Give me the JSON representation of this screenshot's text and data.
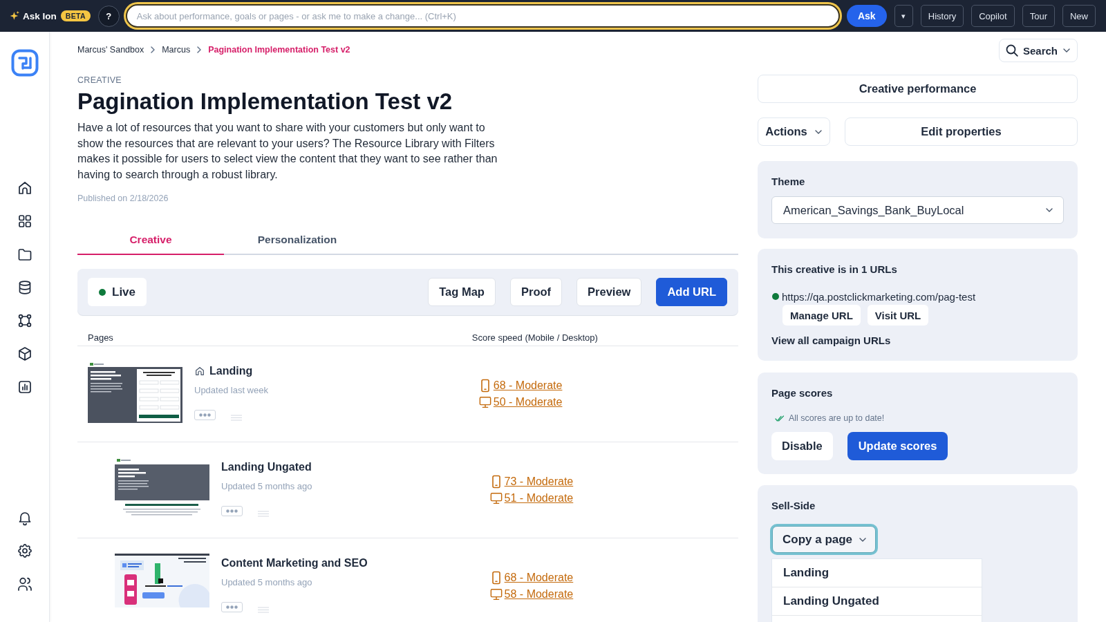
{
  "ask_bar": {
    "title": "Ask Ion",
    "badge": "BETA",
    "help": "?",
    "search": {
      "placeholder": "Ask about performance, goals or pages - or ask me to make a change... (Ctrl+K)"
    },
    "ask_button": "Ask",
    "menu_button": "▾",
    "buttons": [
      "History",
      "Copilot",
      "Tour",
      "New"
    ]
  },
  "breadcrumb": [
    {
      "label": "Marcus' Sandbox",
      "current": false
    },
    {
      "label": "Marcus",
      "current": false
    },
    {
      "label": "Pagination Implementation Test v2",
      "current": true
    }
  ],
  "header": {
    "eyebrow": "CREATIVE",
    "title": "Pagination Implementation Test v2",
    "description": "Have a lot of resources that you want to share with your customers but only want to show the resources that are relevant to your users? The Resource Library with Filters makes it possible for users to select view the content that they want to see rather than having to search through a robust library.",
    "published": "Published on 2/18/2026"
  },
  "tabs": [
    {
      "label": "Creative",
      "selected": true
    },
    {
      "label": "Personalization",
      "selected": false
    }
  ],
  "toolbar": {
    "status": {
      "label": "Live",
      "kind": "live"
    },
    "buttons": [
      {
        "label": "Tag Map",
        "kind": "secondary"
      },
      {
        "label": "Proof",
        "kind": "secondary"
      },
      {
        "label": "Preview",
        "kind": "secondary"
      },
      {
        "label": "Add URL",
        "kind": "primary"
      }
    ]
  },
  "pages_table": {
    "columns": [
      "Pages",
      "Score speed (Mobile / Desktop)"
    ],
    "rows": [
      {
        "title": "Landing",
        "home": true,
        "updated": "Updated last week",
        "thumbnail": {
          "kind": "form"
        },
        "scores": {
          "mobile": "68 - Moderate",
          "desktop": "50 - Moderate"
        },
        "children": [
          {
            "title": "Landing Ungated",
            "home": false,
            "updated": "Updated 5 months ago",
            "thumbnail": {
              "kind": "banner"
            },
            "scores": {
              "mobile": "73 - Moderate",
              "desktop": "51 - Moderate"
            }
          },
          {
            "title": "Content Marketing and SEO",
            "home": false,
            "updated": "Updated 5 months ago",
            "thumbnail": {
              "kind": "illustration"
            },
            "scores": {
              "mobile": "68 - Moderate",
              "desktop": "58 - Moderate"
            }
          }
        ]
      }
    ]
  },
  "side_panel": {
    "search_button": "Search",
    "performance_button": "Creative performance",
    "actions_button": "Actions",
    "edit_button": "Edit properties",
    "theme": {
      "label": "Theme",
      "value": "American_Savings_Bank_BuyLocal"
    },
    "urls": {
      "title": "This creative is in 1 URLs",
      "items": [
        {
          "url": "https://qa.postclickmarketing.com/pag-test",
          "kind": "live",
          "buttons": [
            "Manage URL",
            "Visit URL"
          ]
        }
      ],
      "link": "View all campaign URLs"
    },
    "page_scores": {
      "title": "Page scores",
      "status": "All scores are up to date!",
      "buttons": [
        {
          "label": "Disable",
          "kind": "secondary"
        },
        {
          "label": "Update scores",
          "kind": "primary"
        }
      ]
    },
    "sell_side": {
      "title": "Sell-Side",
      "dropdown": {
        "label": "Copy a page",
        "focused": true,
        "expanded": true,
        "options": [
          "Landing",
          "Landing Ungated"
        ]
      }
    }
  }
}
